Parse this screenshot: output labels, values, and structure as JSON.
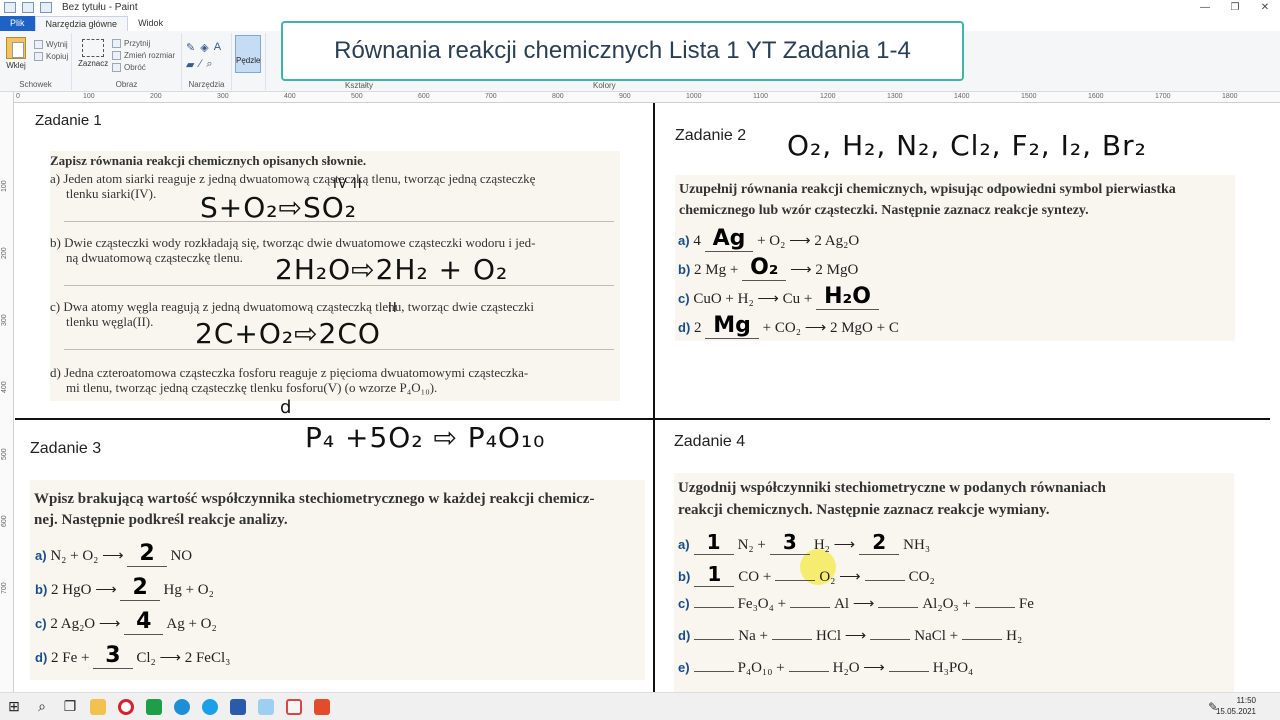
{
  "window": {
    "title": "Bez tytułu - Paint"
  },
  "tabs": [
    "Plik",
    "Narzędzia główne",
    "Widok"
  ],
  "ribbon": {
    "clipboard": {
      "paste": "Wklej",
      "cut": "Wytnij",
      "copy": "Kopiuj",
      "label": "Schowek"
    },
    "image": {
      "select": "Zaznacz",
      "crop": "Przytnij",
      "resize": "Zmień rozmiar",
      "rotate": "Obróć",
      "label": "Obraz"
    },
    "tools": {
      "label": "Narzędzia"
    },
    "brushes": {
      "label": "Pędzle"
    },
    "shapes": {
      "label": "Kształty"
    },
    "colors": {
      "label": "Kolory"
    }
  },
  "overlay_title": "Równania reakcji chemicznych Lista 1 YT Zadania 1-4",
  "ruler_ticks": [
    "0",
    "100",
    "200",
    "300",
    "400",
    "500",
    "600",
    "700",
    "800",
    "900",
    "1000",
    "1100",
    "1200",
    "1300",
    "1400",
    "1500",
    "1600",
    "1700",
    "1800"
  ],
  "vruler_ticks": [
    "100",
    "200",
    "300",
    "400",
    "500",
    "600",
    "700"
  ],
  "zadanie1": {
    "title": "Zadanie 1",
    "instruction": "Zapisz równania reakcji chemicznych opisanych słownie.",
    "a": "a) Jeden atom siarki reaguje z jedną dwuatomową cząsteczką tlenu, tworząc jedną cząsteczkę",
    "a2": "tlenku siarki(IV).",
    "a_answer": "S+O₂⇨SO₂",
    "a_valence": "IV II",
    "b": "b) Dwie cząsteczki wody rozkładają się, tworząc dwie dwuatomowe cząsteczki wodoru i jed-",
    "b2": "ną dwuatomową cząsteczkę tlenu.",
    "b_answer": "2H₂O⇨2H₂ + O₂",
    "c": "c) Dwa atomy węgla reagują z jedną dwuatomową cząsteczką tlenu, tworząc dwie cząsteczki",
    "c2": "tlenku węgla(II).",
    "c_answer": "2C+O₂⇨2CO",
    "c_valence": "II",
    "d": "d) Jedna czteroatomowa cząsteczka fosforu reaguje z pięcioma dwuatomowymi cząsteczka-",
    "d2": "mi tlenu, tworząc jedną cząsteczkę tlenku fosforu(V) (o wzorze P₄O₁₀).",
    "d_marker": "d",
    "d_answer": "P₄ +5O₂ ⇨ P₄O₁₀"
  },
  "zadanie2": {
    "title": "Zadanie 2",
    "elements": "O₂, H₂, N₂, Cl₂, F₂, I₂, Br₂",
    "instruction1": "Uzupełnij równania reakcji chemicznych, wpisując odpowiedni symbol pierwiastka",
    "instruction2": "chemicznego lub wzór cząsteczki. Następnie zaznacz reakcje syntezy.",
    "lines": [
      {
        "lbl": "a)",
        "pre": "4",
        "ans": "Ag",
        "post": "+ O₂ ⟶ 2 Ag₂O"
      },
      {
        "lbl": "b)",
        "pre": "2 Mg +",
        "ans": "O₂",
        "post": "⟶ 2 MgO"
      },
      {
        "lbl": "c)",
        "pre": "CuO + H₂ ⟶ Cu +",
        "ans": "H₂O",
        "post": ""
      },
      {
        "lbl": "d)",
        "pre": "2",
        "ans": "Mg",
        "post": "+ CO₂ ⟶ 2 MgO + C"
      }
    ]
  },
  "zadanie3": {
    "title": "Zadanie 3",
    "instruction1": "Wpisz brakującą wartość współczynnika stechiometrycznego w każdej reakcji chemicz-",
    "instruction2": "nej. Następnie podkreśl reakcje analizy.",
    "lines": [
      {
        "lbl": "a)",
        "pre": "N₂ + O₂ ⟶",
        "ans": "2",
        "post": "NO"
      },
      {
        "lbl": "b)",
        "pre": "2 HgO ⟶",
        "ans": "2",
        "post": "Hg + O₂"
      },
      {
        "lbl": "c)",
        "pre": "2 Ag₂O ⟶",
        "ans": "4",
        "post": "Ag + O₂"
      },
      {
        "lbl": "d)",
        "pre": "2 Fe +",
        "ans": "3",
        "post": "Cl₂ ⟶ 2 FeCl₃"
      }
    ]
  },
  "zadanie4": {
    "title": "Zadanie 4",
    "instruction1": "Uzgodnij współczynniki stechiometryczne w podanych równaniach",
    "instruction2": "reakcji chemicznych. Następnie zaznacz reakcje wymiany.",
    "lines": [
      {
        "lbl": "a)",
        "a1": "1",
        "t1": "N₂ +",
        "a2": "3",
        "t2": "H₂ ⟶",
        "a3": "2",
        "t3": "NH₃",
        "a4": "",
        "t4": ""
      },
      {
        "lbl": "b)",
        "a1": "1",
        "t1": "CO +",
        "a2": "",
        "t2": "O₂ ⟶",
        "a3": "",
        "t3": "CO₂",
        "a4": "",
        "t4": ""
      },
      {
        "lbl": "c)",
        "a1": "",
        "t1": "Fe₃O₄ +",
        "a2": "",
        "t2": "Al ⟶",
        "a3": "",
        "t3": "Al₂O₃ +",
        "a4": "",
        "t4": "Fe"
      },
      {
        "lbl": "d)",
        "a1": "",
        "t1": "Na +",
        "a2": "",
        "t2": "HCl ⟶",
        "a3": "",
        "t3": "NaCl +",
        "a4": "",
        "t4": "H₂"
      },
      {
        "lbl": "e)",
        "a1": "",
        "t1": "P₄O₁₀ +",
        "a2": "",
        "t2": "H₂O ⟶",
        "a3": "",
        "t3": "H₃PO₄",
        "a4": "",
        "t4": ""
      }
    ]
  },
  "taskbar": {
    "time": "11:50",
    "date": "15.05.2021"
  }
}
